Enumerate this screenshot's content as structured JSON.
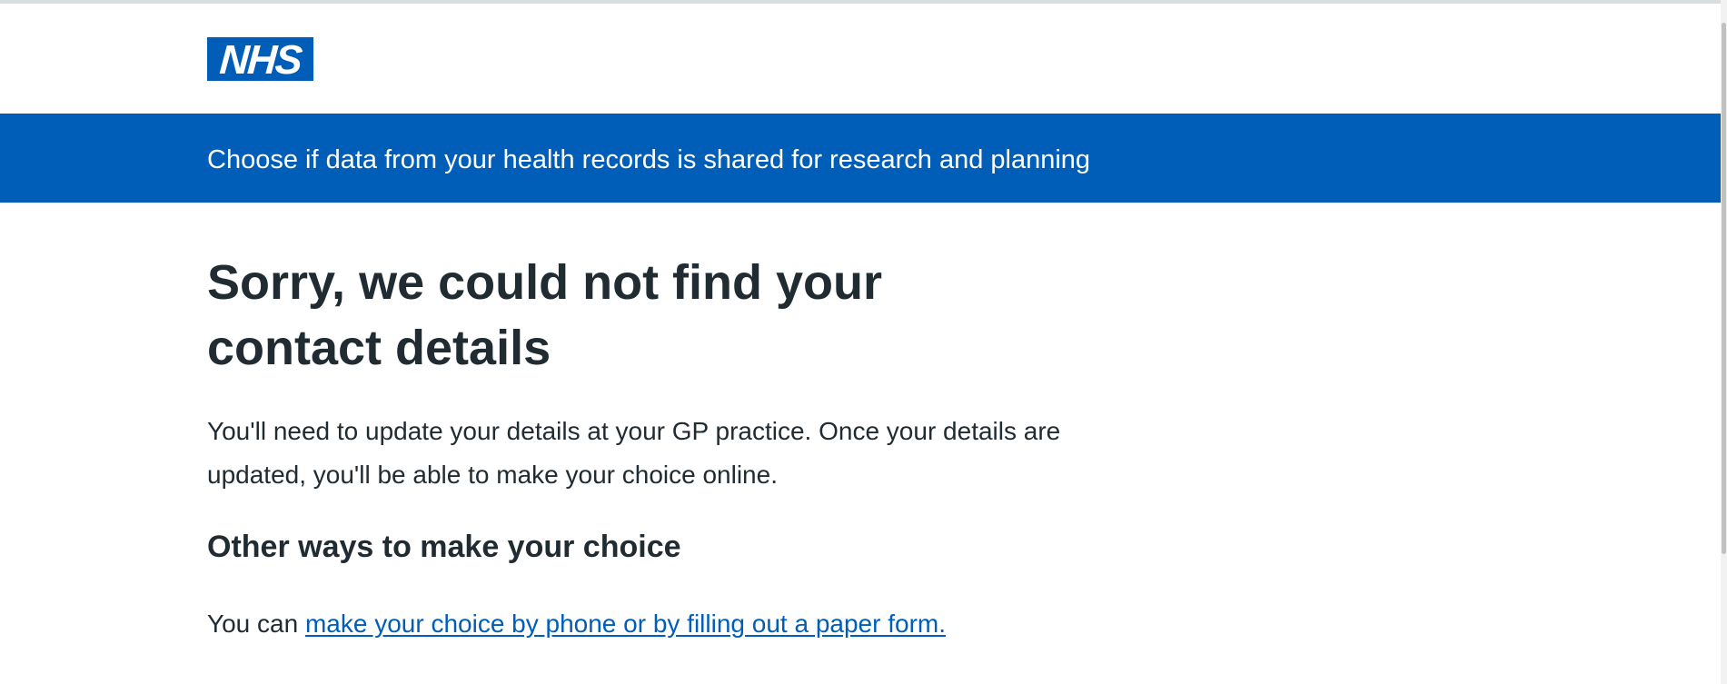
{
  "header": {
    "logo_text": "NHS",
    "service_name": "Choose if data from your health records is shared for research and planning"
  },
  "main": {
    "title": "Sorry, we could not find your contact details",
    "intro": "You'll need to update your details at your GP practice. Once your details are updated, you'll be able to make your choice online.",
    "subheading": "Other ways to make your choice",
    "choice_prefix": "You can ",
    "choice_link": "make your choice by phone or by filling out a paper form."
  },
  "colors": {
    "nhs_blue": "#005eb8",
    "text": "#212b32",
    "background": "#ffffff"
  },
  "icons": {
    "logo": "nhs-logo"
  }
}
